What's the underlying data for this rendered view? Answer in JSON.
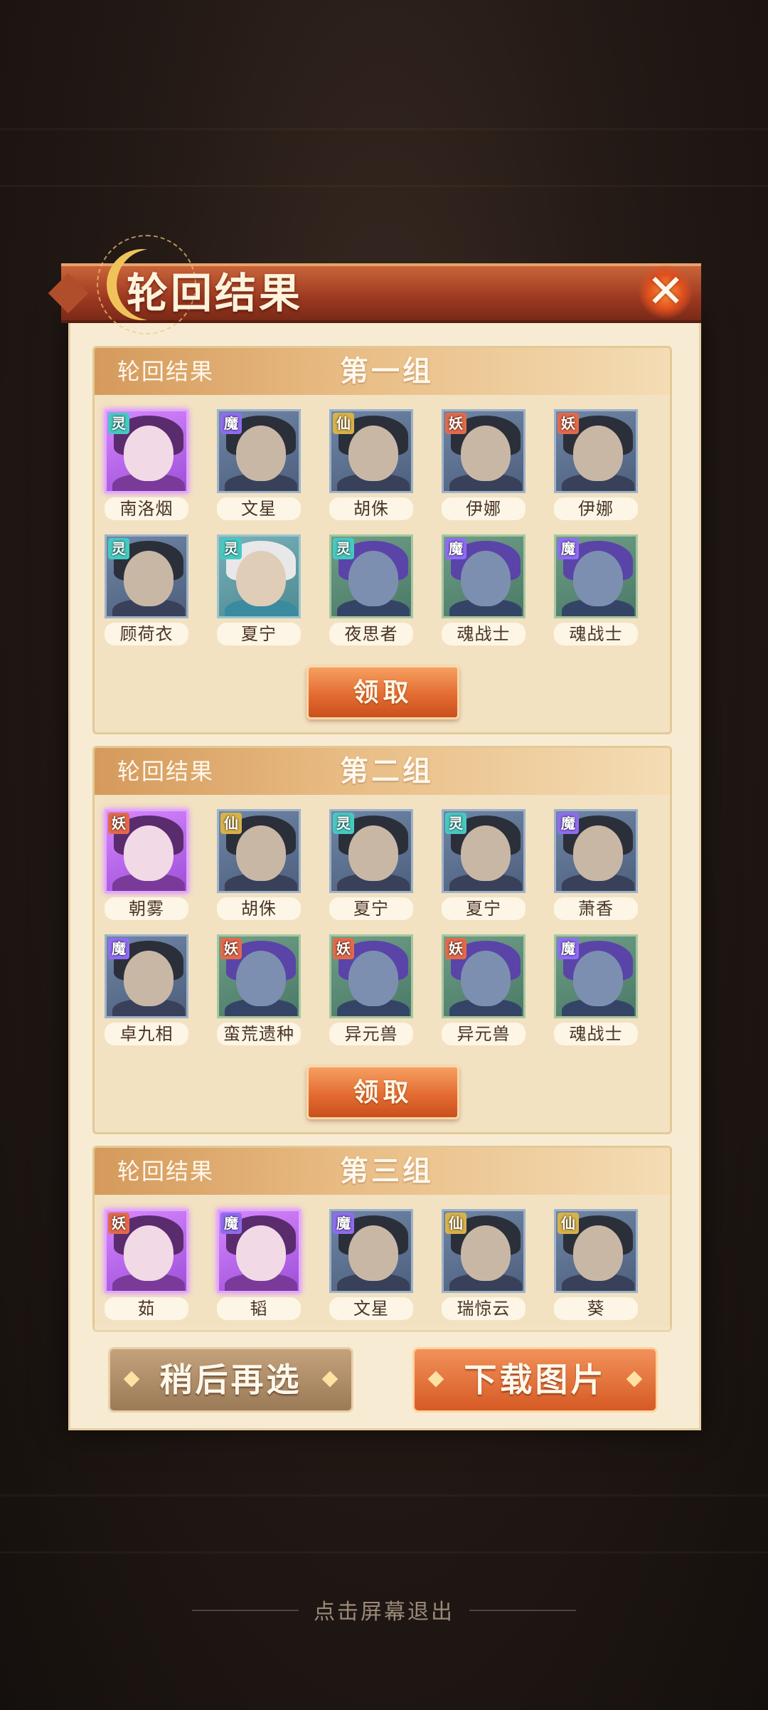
{
  "modal": {
    "title": "轮回结果",
    "close_icon": "close-icon"
  },
  "groups": [
    {
      "label": "轮回结果",
      "name": "第一组",
      "claim_label": "领取",
      "characters": [
        {
          "name": "南洛烟",
          "tag": "灵",
          "rarity": "purple"
        },
        {
          "name": "文星",
          "tag": "魔",
          "rarity": "blue"
        },
        {
          "name": "胡侏",
          "tag": "仙",
          "rarity": "blue"
        },
        {
          "name": "伊娜",
          "tag": "妖",
          "rarity": "blue"
        },
        {
          "name": "伊娜",
          "tag": "妖",
          "rarity": "blue"
        },
        {
          "name": "顾荷衣",
          "tag": "灵",
          "rarity": "blue"
        },
        {
          "name": "夏宁",
          "tag": "灵",
          "rarity": "teal"
        },
        {
          "name": "夜思者",
          "tag": "灵",
          "rarity": "green"
        },
        {
          "name": "魂战士",
          "tag": "魔",
          "rarity": "green"
        },
        {
          "name": "魂战士",
          "tag": "魔",
          "rarity": "green"
        }
      ]
    },
    {
      "label": "轮回结果",
      "name": "第二组",
      "claim_label": "领取",
      "characters": [
        {
          "name": "朝雾",
          "tag": "妖",
          "rarity": "purple"
        },
        {
          "name": "胡侏",
          "tag": "仙",
          "rarity": "blue"
        },
        {
          "name": "夏宁",
          "tag": "灵",
          "rarity": "blue"
        },
        {
          "name": "夏宁",
          "tag": "灵",
          "rarity": "blue"
        },
        {
          "name": "萧香",
          "tag": "魔",
          "rarity": "blue"
        },
        {
          "name": "卓九相",
          "tag": "魔",
          "rarity": "blue"
        },
        {
          "name": "蛮荒遗种",
          "tag": "妖",
          "rarity": "green"
        },
        {
          "name": "异元兽",
          "tag": "妖",
          "rarity": "green"
        },
        {
          "name": "异元兽",
          "tag": "妖",
          "rarity": "green"
        },
        {
          "name": "魂战士",
          "tag": "魔",
          "rarity": "green"
        }
      ]
    },
    {
      "label": "轮回结果",
      "name": "第三组",
      "characters": [
        {
          "name": "茹",
          "tag": "妖",
          "rarity": "purple"
        },
        {
          "name": "韬",
          "tag": "魔",
          "rarity": "purple"
        },
        {
          "name": "文星",
          "tag": "魔",
          "rarity": "blue"
        },
        {
          "name": "瑞惊云",
          "tag": "仙",
          "rarity": "blue"
        },
        {
          "name": "葵",
          "tag": "仙",
          "rarity": "blue"
        }
      ]
    }
  ],
  "footer": {
    "later_label": "稍后再选",
    "download_label": "下载图片"
  },
  "exit_hint": "点击屏幕退出",
  "colors": {
    "accent": "#e46c32",
    "ribbon": "#9c3820",
    "panel": "#f2e2c2"
  }
}
